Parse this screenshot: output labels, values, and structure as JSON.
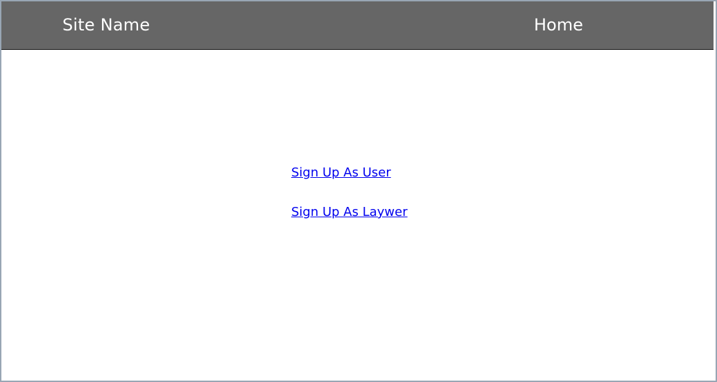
{
  "header": {
    "site_name": "Site Name",
    "home_label": "Home"
  },
  "main": {
    "links": [
      {
        "label": "Sign Up As User"
      },
      {
        "label": "Sign Up As Laywer"
      }
    ]
  },
  "colors": {
    "header_bg": "#666666",
    "link": "#0000ee",
    "frame_border": "#98a6b4"
  }
}
